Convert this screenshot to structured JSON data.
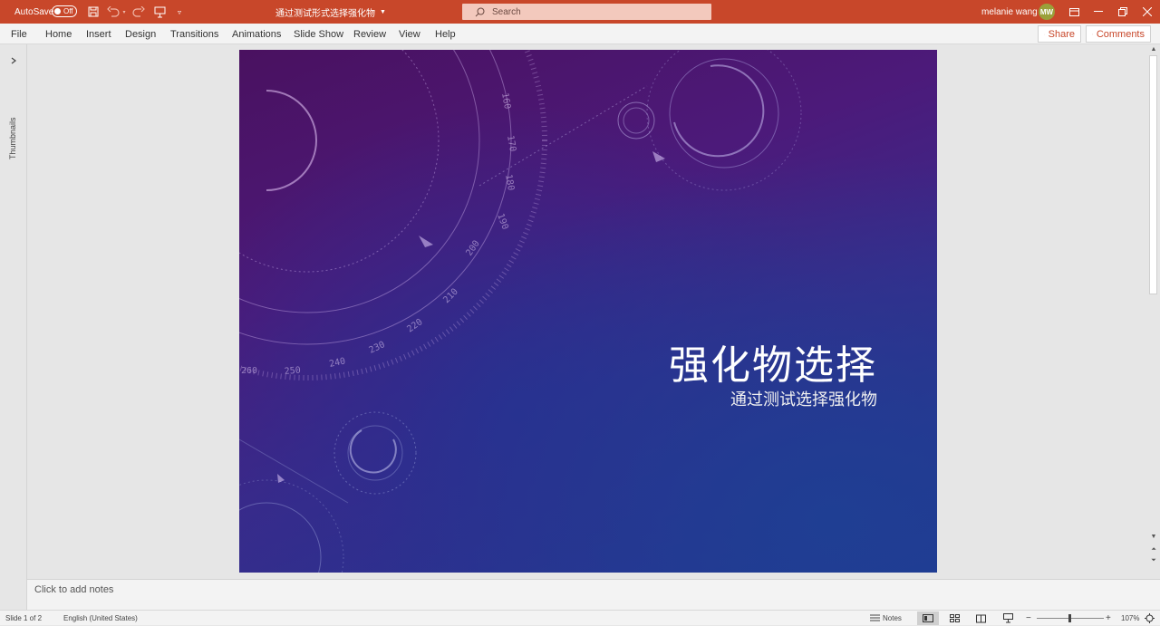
{
  "titlebar": {
    "autosave_label": "AutoSave",
    "autosave_state": "Off",
    "document_title": "通过测试形式选择强化物",
    "search_placeholder": "Search",
    "user_name": "melanie wang",
    "user_initials": "MW",
    "accent_color": "#c8472a"
  },
  "ribbon": {
    "tabs": [
      "File",
      "Home",
      "Insert",
      "Design",
      "Transitions",
      "Animations",
      "Slide Show",
      "Review",
      "View",
      "Help"
    ],
    "share_label": "Share",
    "comments_label": "Comments"
  },
  "thumbnails": {
    "label": "Thumbnails"
  },
  "slide": {
    "title": "强化物选择",
    "subtitle": "通过测试选择强化物",
    "dial_numbers": [
      "160",
      "170",
      "180",
      "190",
      "200",
      "210",
      "220",
      "230",
      "240",
      "250",
      "250",
      "260"
    ]
  },
  "notes": {
    "placeholder": "Click to add notes"
  },
  "status": {
    "slide_indicator": "Slide 1 of 2",
    "language": "English (United States)",
    "notes_label": "Notes",
    "zoom_minus": "−",
    "zoom_plus": "+",
    "zoom_level": "107%"
  }
}
